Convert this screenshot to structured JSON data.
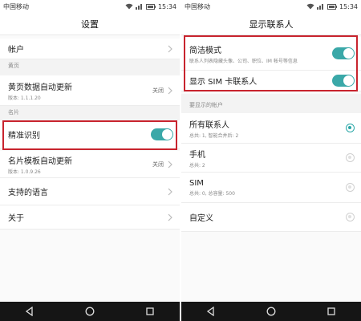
{
  "status_bar": {
    "carrier": "中国移动",
    "time": "15:34"
  },
  "left": {
    "title": "设置",
    "account": {
      "label": "帐户"
    },
    "section_yellow": "黄页",
    "yellow_update": {
      "label": "黄页数据自动更新",
      "version": "版本: 1.1.1.20",
      "value": "关闭"
    },
    "section_card": "名片",
    "precise": {
      "label": "精准识别"
    },
    "card_update": {
      "label": "名片模板自动更新",
      "version": "版本: 1.0.9.26",
      "value": "关闭"
    },
    "language": {
      "label": "支持的语言"
    },
    "about": {
      "label": "关于"
    }
  },
  "right": {
    "title": "显示联系人",
    "simple_mode": {
      "label": "简洁模式",
      "desc": "联系人列表隐藏头像、公司、职位、IM 帐号等信息"
    },
    "show_sim": {
      "label": "显示 SIM 卡联系人"
    },
    "section_accounts": "要显示的帐户",
    "accounts": [
      {
        "label": "所有联系人",
        "sub": "总共: 1, 智能合并后: 2",
        "selected": true
      },
      {
        "label": "手机",
        "sub": "总共: 2",
        "selected": false
      },
      {
        "label": "SIM",
        "sub": "总共: 0, 总容量: 500",
        "selected": false
      },
      {
        "label": "自定义",
        "sub": "",
        "selected": false
      }
    ]
  },
  "colors": {
    "accent": "#3aa8a8",
    "highlight": "#c8242e",
    "navbar": "#151515"
  },
  "icons": [
    "wifi-icon",
    "signal-icon",
    "battery-icon",
    "chevron-right-icon",
    "back-icon",
    "home-icon",
    "recents-icon"
  ]
}
